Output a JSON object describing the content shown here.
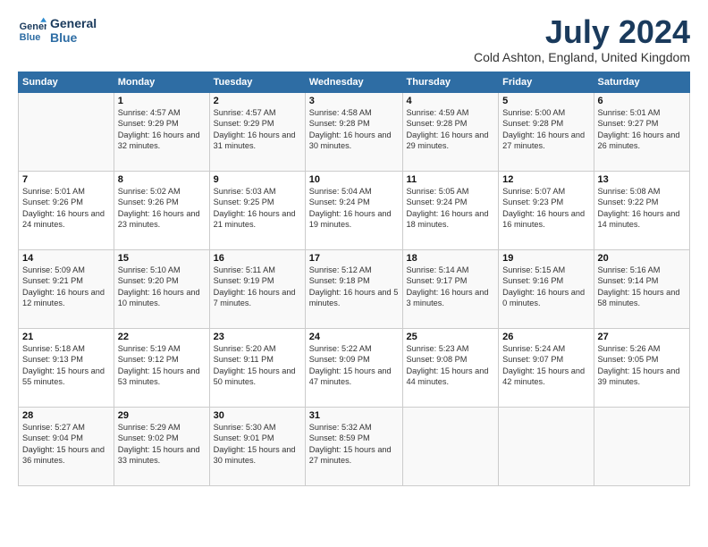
{
  "logo": {
    "line1": "General",
    "line2": "Blue"
  },
  "title": "July 2024",
  "subtitle": "Cold Ashton, England, United Kingdom",
  "days_of_week": [
    "Sunday",
    "Monday",
    "Tuesday",
    "Wednesday",
    "Thursday",
    "Friday",
    "Saturday"
  ],
  "weeks": [
    [
      {
        "num": "",
        "empty": true
      },
      {
        "num": "1",
        "rise": "4:57 AM",
        "set": "9:29 PM",
        "daylight": "16 hours and 32 minutes."
      },
      {
        "num": "2",
        "rise": "4:57 AM",
        "set": "9:29 PM",
        "daylight": "16 hours and 31 minutes."
      },
      {
        "num": "3",
        "rise": "4:58 AM",
        "set": "9:28 PM",
        "daylight": "16 hours and 30 minutes."
      },
      {
        "num": "4",
        "rise": "4:59 AM",
        "set": "9:28 PM",
        "daylight": "16 hours and 29 minutes."
      },
      {
        "num": "5",
        "rise": "5:00 AM",
        "set": "9:28 PM",
        "daylight": "16 hours and 27 minutes."
      },
      {
        "num": "6",
        "rise": "5:01 AM",
        "set": "9:27 PM",
        "daylight": "16 hours and 26 minutes."
      }
    ],
    [
      {
        "num": "7",
        "rise": "5:01 AM",
        "set": "9:26 PM",
        "daylight": "16 hours and 24 minutes."
      },
      {
        "num": "8",
        "rise": "5:02 AM",
        "set": "9:26 PM",
        "daylight": "16 hours and 23 minutes."
      },
      {
        "num": "9",
        "rise": "5:03 AM",
        "set": "9:25 PM",
        "daylight": "16 hours and 21 minutes."
      },
      {
        "num": "10",
        "rise": "5:04 AM",
        "set": "9:24 PM",
        "daylight": "16 hours and 19 minutes."
      },
      {
        "num": "11",
        "rise": "5:05 AM",
        "set": "9:24 PM",
        "daylight": "16 hours and 18 minutes."
      },
      {
        "num": "12",
        "rise": "5:07 AM",
        "set": "9:23 PM",
        "daylight": "16 hours and 16 minutes."
      },
      {
        "num": "13",
        "rise": "5:08 AM",
        "set": "9:22 PM",
        "daylight": "16 hours and 14 minutes."
      }
    ],
    [
      {
        "num": "14",
        "rise": "5:09 AM",
        "set": "9:21 PM",
        "daylight": "16 hours and 12 minutes."
      },
      {
        "num": "15",
        "rise": "5:10 AM",
        "set": "9:20 PM",
        "daylight": "16 hours and 10 minutes."
      },
      {
        "num": "16",
        "rise": "5:11 AM",
        "set": "9:19 PM",
        "daylight": "16 hours and 7 minutes."
      },
      {
        "num": "17",
        "rise": "5:12 AM",
        "set": "9:18 PM",
        "daylight": "16 hours and 5 minutes."
      },
      {
        "num": "18",
        "rise": "5:14 AM",
        "set": "9:17 PM",
        "daylight": "16 hours and 3 minutes."
      },
      {
        "num": "19",
        "rise": "5:15 AM",
        "set": "9:16 PM",
        "daylight": "16 hours and 0 minutes."
      },
      {
        "num": "20",
        "rise": "5:16 AM",
        "set": "9:14 PM",
        "daylight": "15 hours and 58 minutes."
      }
    ],
    [
      {
        "num": "21",
        "rise": "5:18 AM",
        "set": "9:13 PM",
        "daylight": "15 hours and 55 minutes."
      },
      {
        "num": "22",
        "rise": "5:19 AM",
        "set": "9:12 PM",
        "daylight": "15 hours and 53 minutes."
      },
      {
        "num": "23",
        "rise": "5:20 AM",
        "set": "9:11 PM",
        "daylight": "15 hours and 50 minutes."
      },
      {
        "num": "24",
        "rise": "5:22 AM",
        "set": "9:09 PM",
        "daylight": "15 hours and 47 minutes."
      },
      {
        "num": "25",
        "rise": "5:23 AM",
        "set": "9:08 PM",
        "daylight": "15 hours and 44 minutes."
      },
      {
        "num": "26",
        "rise": "5:24 AM",
        "set": "9:07 PM",
        "daylight": "15 hours and 42 minutes."
      },
      {
        "num": "27",
        "rise": "5:26 AM",
        "set": "9:05 PM",
        "daylight": "15 hours and 39 minutes."
      }
    ],
    [
      {
        "num": "28",
        "rise": "5:27 AM",
        "set": "9:04 PM",
        "daylight": "15 hours and 36 minutes."
      },
      {
        "num": "29",
        "rise": "5:29 AM",
        "set": "9:02 PM",
        "daylight": "15 hours and 33 minutes."
      },
      {
        "num": "30",
        "rise": "5:30 AM",
        "set": "9:01 PM",
        "daylight": "15 hours and 30 minutes."
      },
      {
        "num": "31",
        "rise": "5:32 AM",
        "set": "8:59 PM",
        "daylight": "15 hours and 27 minutes."
      },
      {
        "num": "",
        "empty": true
      },
      {
        "num": "",
        "empty": true
      },
      {
        "num": "",
        "empty": true
      }
    ]
  ],
  "labels": {
    "sunrise": "Sunrise:",
    "sunset": "Sunset:",
    "daylight": "Daylight:"
  }
}
